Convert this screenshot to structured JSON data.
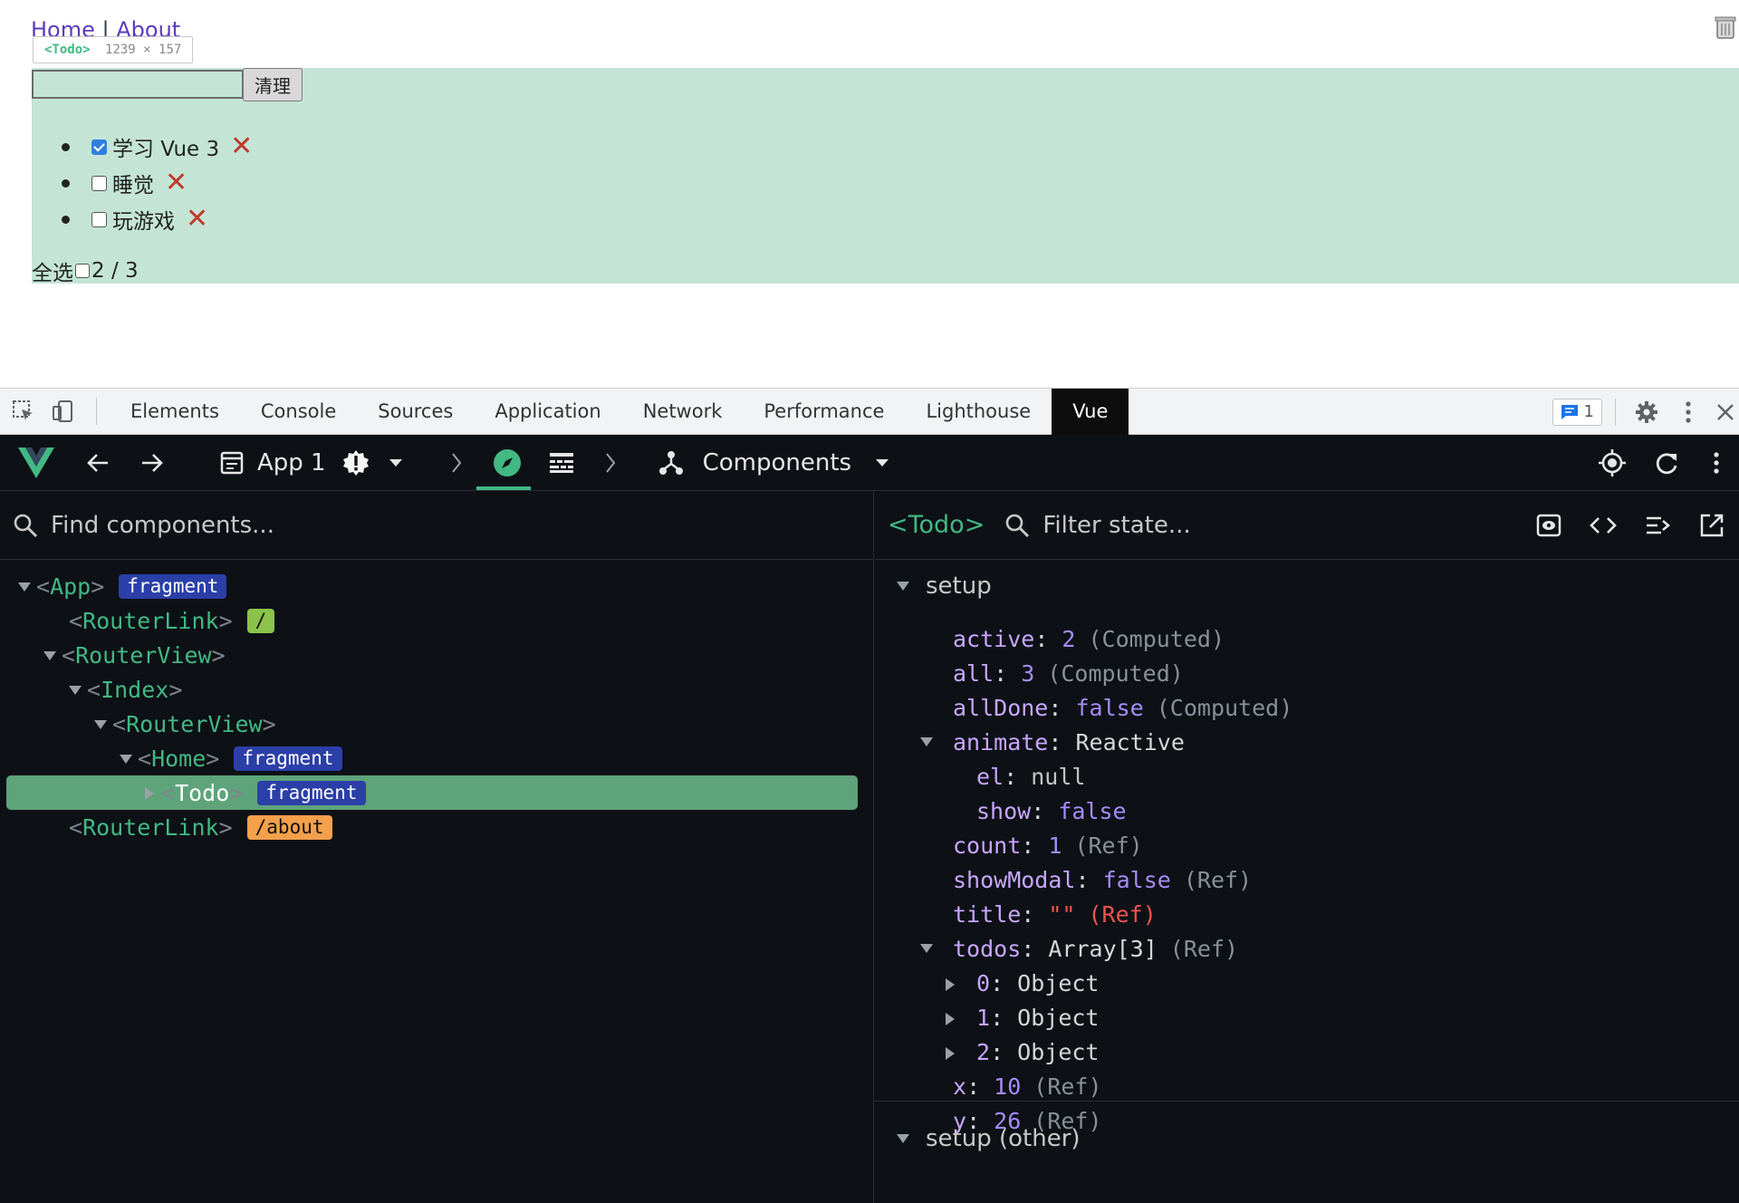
{
  "page": {
    "nav": {
      "home": "Home",
      "sep": "|",
      "about": "About"
    },
    "tooltip": {
      "tag": "<Todo>",
      "size": "1239 × 157"
    },
    "input": {
      "value": "",
      "placeholder": ""
    },
    "clear_label": "清理",
    "todos": [
      {
        "text": "学习 Vue 3",
        "done": true
      },
      {
        "text": "睡觉",
        "done": false
      },
      {
        "text": "玩游戏",
        "done": false
      }
    ],
    "delete_glyph": "✕",
    "select_all_label": "全选",
    "progress_text": "2 / 3"
  },
  "devtools_tabs": [
    "Elements",
    "Console",
    "Sources",
    "Application",
    "Network",
    "Performance",
    "Lighthouse",
    "Vue"
  ],
  "devtools_active_tab": "Vue",
  "message_count": "1",
  "vue_toolbar": {
    "app_label": "App 1",
    "components_label": "Components"
  },
  "left_pane": {
    "search_placeholder": "Find components...",
    "tree": [
      {
        "name": "App",
        "badge": "fragment",
        "badge_kind": "frag"
      },
      {
        "name": "RouterLink",
        "badge": "/",
        "badge_kind": "route"
      },
      {
        "name": "RouterView",
        "badge": ""
      },
      {
        "name": "Index",
        "badge": ""
      },
      {
        "name": "RouterView",
        "badge": ""
      },
      {
        "name": "Home",
        "badge": "fragment",
        "badge_kind": "frag"
      },
      {
        "name": "Todo",
        "badge": "fragment",
        "badge_kind": "frag",
        "selected": true
      },
      {
        "name": "RouterLink",
        "badge": "/about",
        "badge_kind": "about"
      }
    ]
  },
  "right_pane": {
    "component_tag": "<Todo>",
    "filter_placeholder": "Filter state...",
    "section_setup": "setup",
    "section_setup_other": "setup (other)",
    "state": [
      {
        "key": "active",
        "value": "2",
        "vkind": "num",
        "type": "(Computed)"
      },
      {
        "key": "all",
        "value": "3",
        "vkind": "num",
        "type": "(Computed)"
      },
      {
        "key": "allDone",
        "value": "false",
        "vkind": "bool",
        "type": "(Computed)"
      },
      {
        "key": "animate",
        "value": "Reactive",
        "vkind": "plain",
        "type": ""
      },
      {
        "key": "el",
        "value": "null",
        "vkind": "null",
        "type": ""
      },
      {
        "key": "show",
        "value": "false",
        "vkind": "bool",
        "type": ""
      },
      {
        "key": "count",
        "value": "1",
        "vkind": "num",
        "type": "(Ref)"
      },
      {
        "key": "showModal",
        "value": "false",
        "vkind": "bool",
        "type": "(Ref)"
      },
      {
        "key": "title",
        "value": "\"\"",
        "vkind": "str",
        "type": "(Ref)"
      },
      {
        "key": "todos",
        "value": "Array[3]",
        "vkind": "plain",
        "type": "(Ref)"
      },
      {
        "key": "0",
        "value": "Object",
        "vkind": "plain",
        "type": ""
      },
      {
        "key": "1",
        "value": "Object",
        "vkind": "plain",
        "type": ""
      },
      {
        "key": "2",
        "value": "Object",
        "vkind": "plain",
        "type": ""
      },
      {
        "key": "x",
        "value": "10",
        "vkind": "num",
        "type": "(Ref)"
      },
      {
        "key": "y",
        "value": "26",
        "vkind": "num",
        "type": "(Ref)"
      }
    ]
  },
  "colors": {
    "vue_green": "#42b883",
    "highlight": "#c4e5d6",
    "selected_row": "#5ea37a"
  }
}
